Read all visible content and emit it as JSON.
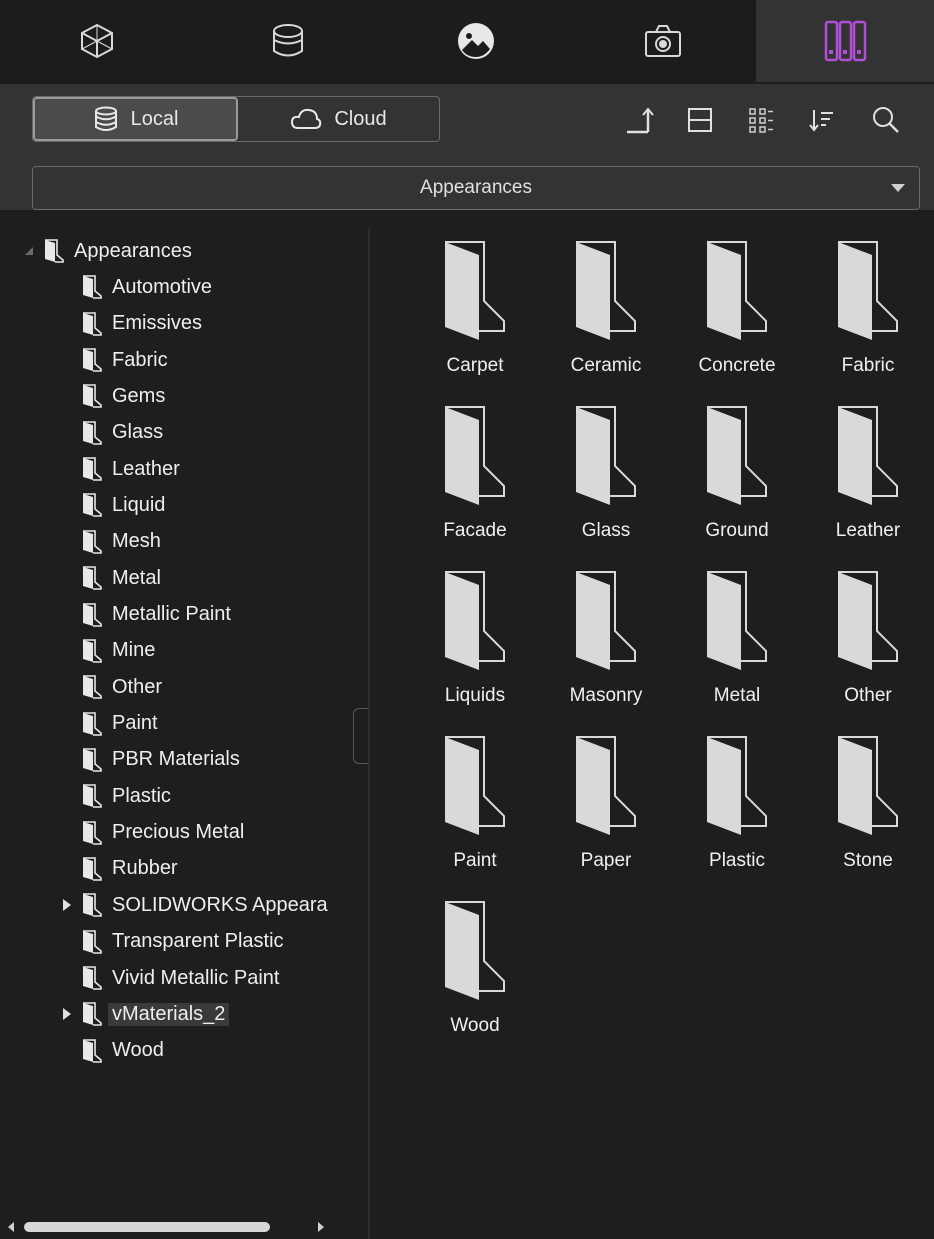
{
  "tabs": [
    {
      "name": "models-tab",
      "icon": "cube-icon",
      "active": false
    },
    {
      "name": "materials-tab",
      "icon": "paint-bucket-icon",
      "active": false
    },
    {
      "name": "environments-tab",
      "icon": "landscape-icon",
      "active": false
    },
    {
      "name": "camera-tab",
      "icon": "camera-icon",
      "active": false
    },
    {
      "name": "library-tab",
      "icon": "library-books-icon",
      "active": true
    }
  ],
  "source_toggle": {
    "local_label": "Local",
    "cloud_label": "Cloud",
    "selected": "Local"
  },
  "toolbar_icons": [
    "up-level-icon",
    "split-view-icon",
    "grid-view-icon",
    "sort-icon",
    "search-icon"
  ],
  "library_select": {
    "value": "Appearances"
  },
  "tree": {
    "root": "Appearances",
    "items": [
      {
        "label": "Automotive",
        "expandable": false
      },
      {
        "label": "Emissives",
        "expandable": false
      },
      {
        "label": "Fabric",
        "expandable": false
      },
      {
        "label": "Gems",
        "expandable": false
      },
      {
        "label": "Glass",
        "expandable": false
      },
      {
        "label": "Leather",
        "expandable": false
      },
      {
        "label": "Liquid",
        "expandable": false
      },
      {
        "label": "Mesh",
        "expandable": false
      },
      {
        "label": "Metal",
        "expandable": false
      },
      {
        "label": "Metallic Paint",
        "expandable": false
      },
      {
        "label": "Mine",
        "expandable": false
      },
      {
        "label": "Other",
        "expandable": false
      },
      {
        "label": "Paint",
        "expandable": false
      },
      {
        "label": "PBR Materials",
        "expandable": false
      },
      {
        "label": "Plastic",
        "expandable": false
      },
      {
        "label": "Precious Metal",
        "expandable": false
      },
      {
        "label": "Rubber",
        "expandable": false
      },
      {
        "label": "SOLIDWORKS Appeara",
        "expandable": true
      },
      {
        "label": "Transparent Plastic",
        "expandable": false
      },
      {
        "label": "Vivid Metallic Paint",
        "expandable": false
      },
      {
        "label": "vMaterials_2",
        "expandable": true,
        "selected": true
      },
      {
        "label": "Wood",
        "expandable": false
      }
    ]
  },
  "grid": {
    "items": [
      "Carpet",
      "Ceramic",
      "Concrete",
      "Fabric",
      "Facade",
      "Glass",
      "Ground",
      "Leather",
      "Liquids",
      "Masonry",
      "Metal",
      "Other",
      "Paint",
      "Paper",
      "Plastic",
      "Stone",
      "Wood"
    ]
  },
  "colors": {
    "accent": "#b14fd6",
    "panel": "#333333",
    "background": "#1e1e1e"
  }
}
